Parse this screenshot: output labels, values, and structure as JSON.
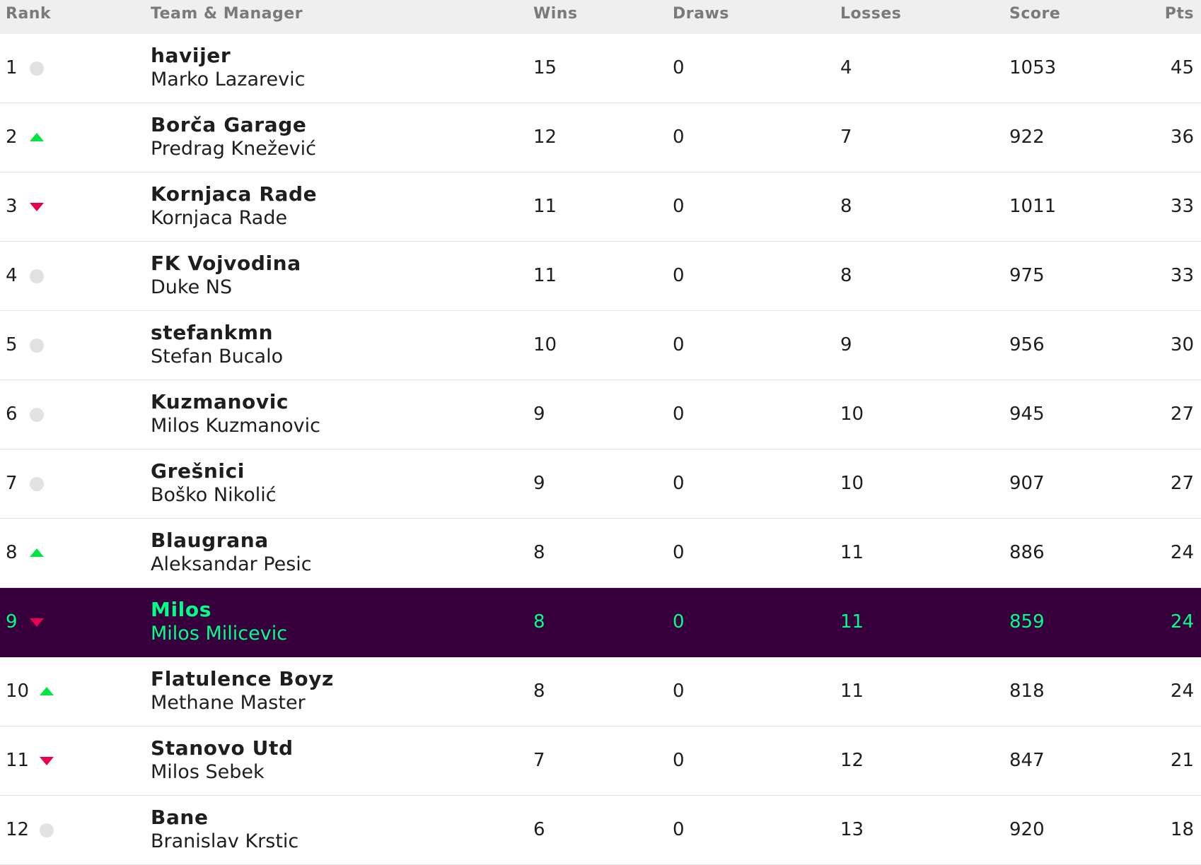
{
  "headers": {
    "rank": "Rank",
    "team": "Team & Manager",
    "wins": "Wins",
    "draws": "Draws",
    "losses": "Losses",
    "score": "Score",
    "pts": "Pts"
  },
  "colors": {
    "highlight_bg": "#37003c",
    "highlight_text": "#00ff87",
    "up": "#00e640",
    "down": "#e90052",
    "same": "#e2e2e2"
  },
  "rows": [
    {
      "rank": "1",
      "move": "same",
      "team": "havijer",
      "manager": "Marko Lazarevic",
      "wins": "15",
      "draws": "0",
      "losses": "4",
      "score": "1053",
      "pts": "45"
    },
    {
      "rank": "2",
      "move": "up",
      "team": "Borča Garage",
      "manager": "Predrag Knežević",
      "wins": "12",
      "draws": "0",
      "losses": "7",
      "score": "922",
      "pts": "36"
    },
    {
      "rank": "3",
      "move": "down",
      "team": "Kornjaca Rade",
      "manager": "Kornjaca Rade",
      "wins": "11",
      "draws": "0",
      "losses": "8",
      "score": "1011",
      "pts": "33"
    },
    {
      "rank": "4",
      "move": "same",
      "team": "FK Vojvodina",
      "manager": "Duke NS",
      "wins": "11",
      "draws": "0",
      "losses": "8",
      "score": "975",
      "pts": "33"
    },
    {
      "rank": "5",
      "move": "same",
      "team": "stefankmn",
      "manager": "Stefan Bucalo",
      "wins": "10",
      "draws": "0",
      "losses": "9",
      "score": "956",
      "pts": "30"
    },
    {
      "rank": "6",
      "move": "same",
      "team": "Kuzmanovic",
      "manager": "Milos Kuzmanovic",
      "wins": "9",
      "draws": "0",
      "losses": "10",
      "score": "945",
      "pts": "27"
    },
    {
      "rank": "7",
      "move": "same",
      "team": "Grešnici",
      "manager": "Boško Nikolić",
      "wins": "9",
      "draws": "0",
      "losses": "10",
      "score": "907",
      "pts": "27"
    },
    {
      "rank": "8",
      "move": "up",
      "team": "Blaugrana",
      "manager": "Aleksandar Pesic",
      "wins": "8",
      "draws": "0",
      "losses": "11",
      "score": "886",
      "pts": "24"
    },
    {
      "rank": "9",
      "move": "down",
      "team": "Milos",
      "manager": "Milos Milicevic",
      "wins": "8",
      "draws": "0",
      "losses": "11",
      "score": "859",
      "pts": "24",
      "highlight": true
    },
    {
      "rank": "10",
      "move": "up",
      "team": "Flatulence Boyz",
      "manager": "Methane Master",
      "wins": "8",
      "draws": "0",
      "losses": "11",
      "score": "818",
      "pts": "24"
    },
    {
      "rank": "11",
      "move": "down",
      "team": "Stanovo Utd",
      "manager": "Milos Sebek",
      "wins": "7",
      "draws": "0",
      "losses": "12",
      "score": "847",
      "pts": "21"
    },
    {
      "rank": "12",
      "move": "same",
      "team": "Bane",
      "manager": "Branislav Krstic",
      "wins": "6",
      "draws": "0",
      "losses": "13",
      "score": "920",
      "pts": "18"
    }
  ]
}
